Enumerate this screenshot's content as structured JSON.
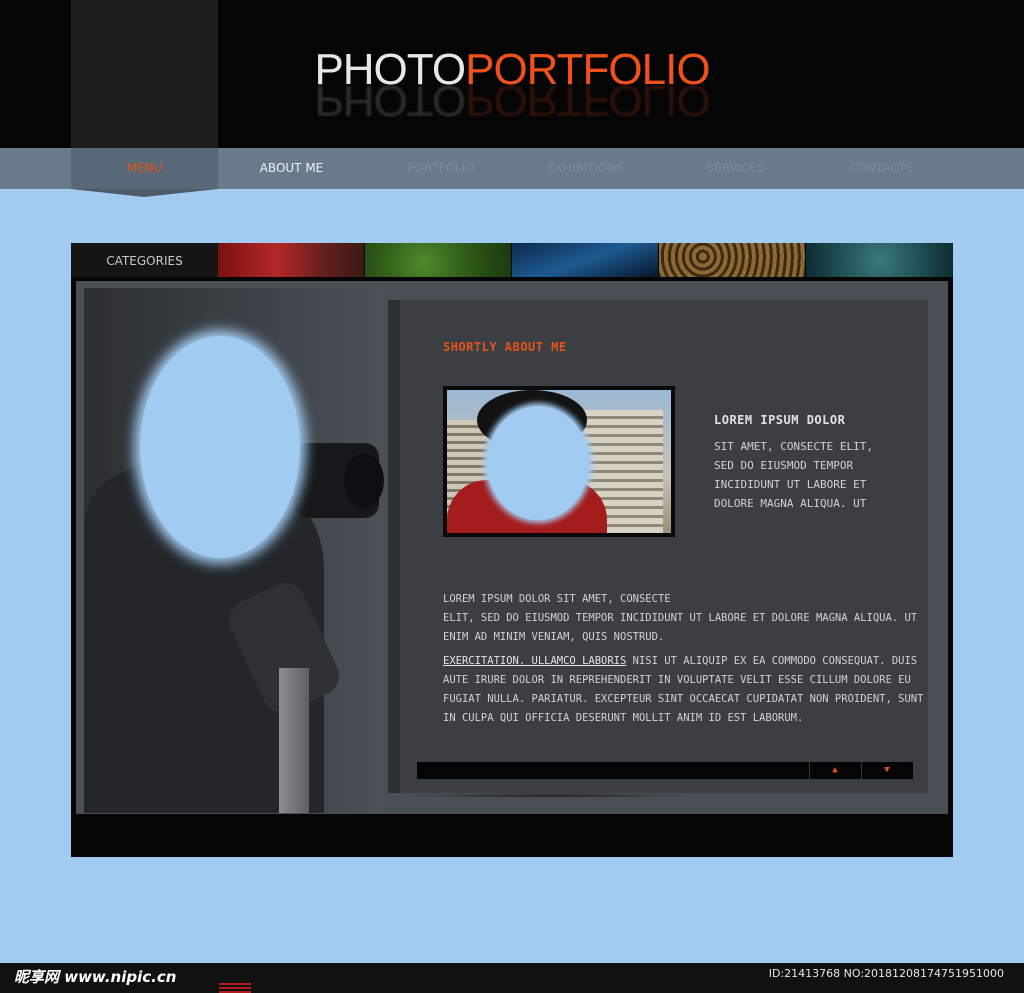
{
  "logo": {
    "part1": "PHOTO",
    "part2": "PORTFOLIO"
  },
  "nav": {
    "items": [
      {
        "label": "MENU",
        "state": "active"
      },
      {
        "label": "ABOUT ME",
        "state": "on"
      },
      {
        "label": "PORTFOLIO",
        "state": "dim"
      },
      {
        "label": "EXHIBITIONS",
        "state": "dim"
      },
      {
        "label": "SERVICES",
        "state": "dim"
      },
      {
        "label": "CONTACTS",
        "state": "dim"
      }
    ]
  },
  "categories": {
    "label": "CATEGORIES"
  },
  "about": {
    "title": "SHORTLY ABOUT ME",
    "side_title": "LOREM IPSUM DOLOR",
    "side_lines": [
      "SIT AMET, CONSECTE ELIT,",
      "SED DO EIUSMOD TEMPOR",
      "INCIDIDUNT UT LABORE ET",
      "DOLORE MAGNA ALIQUA. UT"
    ],
    "para1_lines": [
      "LOREM IPSUM DOLOR SIT AMET, CONSECTE",
      "ELIT, SED DO EIUSMOD TEMPOR INCIDIDUNT UT LABORE ET DOLORE MAGNA ALIQUA. UT",
      "ENIM AD MINIM VENIAM, QUIS NOSTRUD."
    ],
    "para2_link": "EXERCITATION. ULLAMCO LABORIS",
    "para2_first_rest": " NISI UT ALIQUIP EX EA COMMODO CONSEQUAT. DUIS",
    "para2_lines": [
      "AUTE IRURE DOLOR IN REPREHENDERIT IN VOLUPTATE VELIT ESSE CILLUM DOLORE EU",
      "FUGIAT NULLA. PARIATUR. EXCEPTEUR SINT OCCAECAT CUPIDATAT NON PROIDENT, SUNT",
      "IN CULPA QUI OFFICIA DESERUNT MOLLIT ANIM ID EST LABORUM."
    ],
    "up_icon": "▲",
    "down_icon": "▼"
  },
  "watermark": {
    "left": "昵享网 www.nipic.cn",
    "right": "ID:21413768 NO:20181208174751951000"
  },
  "colors": {
    "accent": "#e2531d",
    "background": "#a2cbf1",
    "nav": "#697a89"
  }
}
